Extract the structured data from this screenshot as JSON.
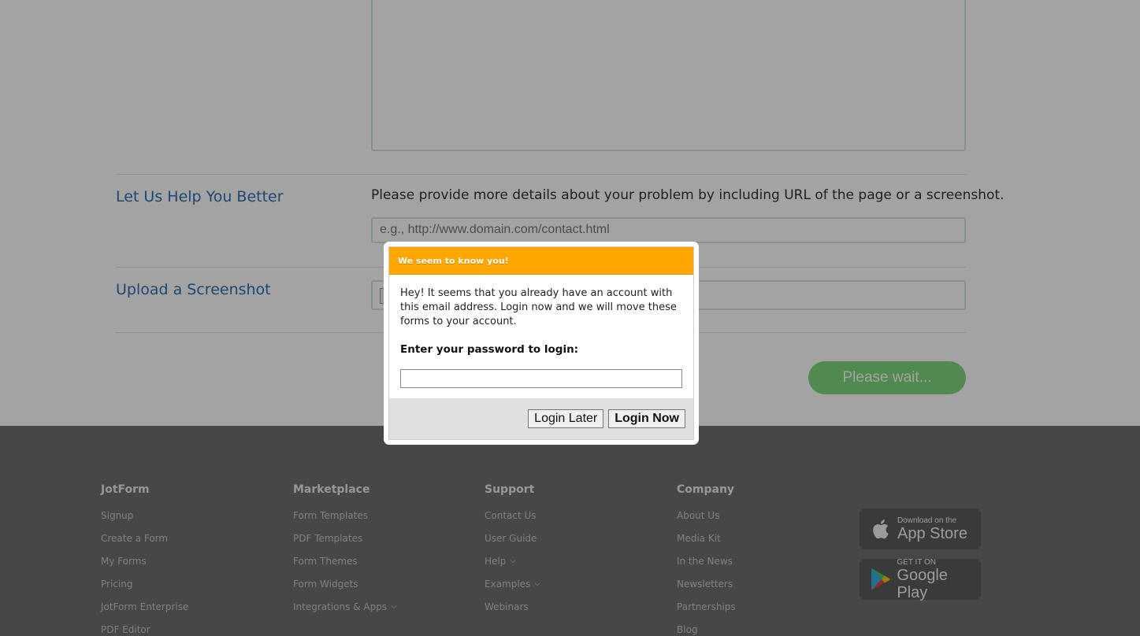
{
  "form": {
    "help_section": {
      "label": "Let Us Help You Better",
      "description": "Please provide more details about your problem by including URL of the page or a screenshot.",
      "url_placeholder": "e.g., http://www.domain.com/contact.html"
    },
    "upload_section": {
      "label": "Upload a Screenshot"
    },
    "submit_label": "Please wait..."
  },
  "footer": {
    "columns": [
      {
        "heading": "JotForm",
        "links": [
          {
            "label": "Signup"
          },
          {
            "label": "Create a Form"
          },
          {
            "label": "My Forms"
          },
          {
            "label": "Pricing"
          },
          {
            "label": "JotForm Enterprise"
          },
          {
            "label": "PDF Editor"
          }
        ]
      },
      {
        "heading": "Marketplace",
        "links": [
          {
            "label": "Form Templates"
          },
          {
            "label": "PDF Templates"
          },
          {
            "label": "Form Themes"
          },
          {
            "label": "Form Widgets"
          },
          {
            "label": "Integrations & Apps",
            "dropdown": true
          }
        ]
      },
      {
        "heading": "Support",
        "links": [
          {
            "label": "Contact Us"
          },
          {
            "label": "User Guide"
          },
          {
            "label": "Help",
            "dropdown": true
          },
          {
            "label": "Examples",
            "dropdown": true
          },
          {
            "label": "Webinars"
          }
        ]
      },
      {
        "heading": "Company",
        "links": [
          {
            "label": "About Us"
          },
          {
            "label": "Media Kit"
          },
          {
            "label": "In the News"
          },
          {
            "label": "Newsletters"
          },
          {
            "label": "Partnerships"
          },
          {
            "label": "Blog"
          }
        ]
      }
    ],
    "badges": {
      "app_store": {
        "small": "Download on the",
        "big": "App Store",
        "icon": "apple-icon"
      },
      "google_play": {
        "small": "GET IT ON",
        "big": "Google Play",
        "icon": "google-play-icon"
      }
    }
  },
  "modal": {
    "title": "We seem to know you!",
    "message": "Hey! It seems that you already have an account with this email address. Login now and we will move these forms to your account.",
    "password_label": "Enter your password to login:",
    "password_value": "",
    "login_later_label": "Login Later",
    "login_now_label": "Login Now"
  },
  "colors": {
    "modal_header": "#ffa600",
    "submit_button": "#7ed87e",
    "section_label": "#2f6fb3",
    "footer_bg": "#6f6f6f"
  }
}
